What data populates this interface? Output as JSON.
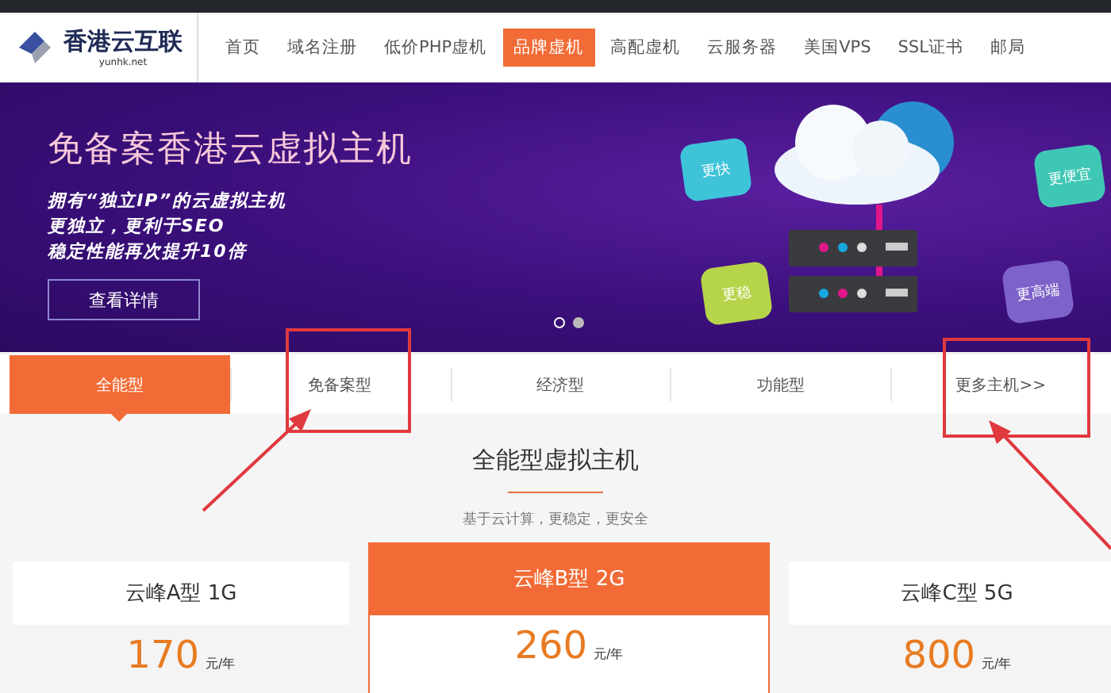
{
  "logo": {
    "name": "香港云互联",
    "domain": "yunhk.net"
  },
  "nav": [
    {
      "label": "首页",
      "selected": false
    },
    {
      "label": "域名注册",
      "selected": false
    },
    {
      "label": "低价PHP虚机",
      "selected": false
    },
    {
      "label": "品牌虚机",
      "selected": true
    },
    {
      "label": "高配虚机",
      "selected": false
    },
    {
      "label": "云服务器",
      "selected": false
    },
    {
      "label": "美国VPS",
      "selected": false
    },
    {
      "label": "SSL证书",
      "selected": false
    },
    {
      "label": "邮局",
      "selected": false
    }
  ],
  "banner": {
    "title": "免备案香港云虚拟主机",
    "lines": [
      "拥有“独立IP”的云虚拟主机",
      "更独立，更利于SEO",
      "稳定性能再次提升10倍"
    ],
    "button": "查看详情",
    "bubbles": [
      {
        "text": "更快",
        "color": "#3ec3d9"
      },
      {
        "text": "更便宜",
        "color": "#3fc7b5"
      },
      {
        "text": "更稳",
        "color": "#b6d44a"
      },
      {
        "text": "更高端",
        "color": "#7d63c9"
      }
    ],
    "dots": [
      {
        "selected": true
      },
      {
        "selected": false
      }
    ]
  },
  "tabs": [
    {
      "label": "全能型",
      "selected": true
    },
    {
      "label": "免备案型",
      "selected": false
    },
    {
      "label": "经济型",
      "selected": false
    },
    {
      "label": "功能型",
      "selected": false
    },
    {
      "label": "更多主机>>",
      "selected": false
    }
  ],
  "section": {
    "title": "全能型虚拟主机",
    "subtitle": "基于云计算，更稳定，更安全"
  },
  "plans": [
    {
      "name": "云峰A型 1G",
      "price": "170",
      "unit": "元/年",
      "featured": false
    },
    {
      "name": "云峰B型 2G",
      "price": "260",
      "unit": "元/年",
      "featured": true
    },
    {
      "name": "云峰C型 5G",
      "price": "800",
      "unit": "元/年",
      "featured": false
    }
  ]
}
